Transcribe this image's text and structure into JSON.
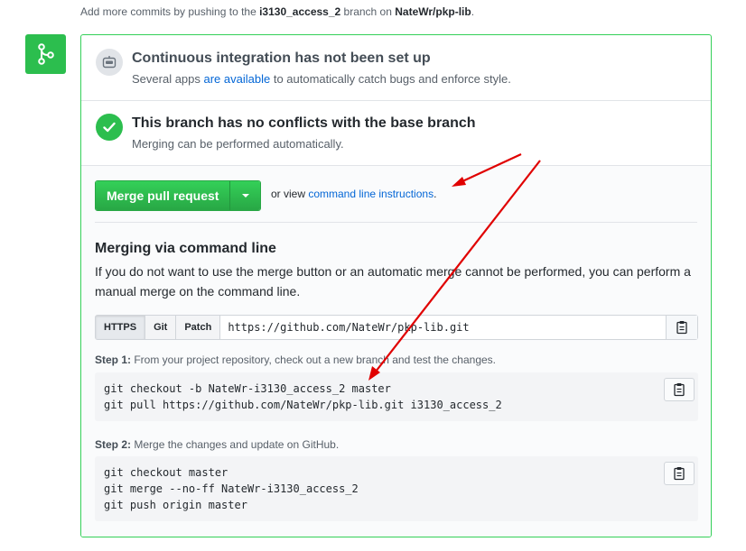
{
  "top_note": {
    "prefix": "Add more commits by pushing to the ",
    "branch": "i3130_access_2",
    "middle": " branch on ",
    "repo": "NateWr/pkp-lib",
    "suffix": "."
  },
  "badge": {
    "icon": "git-merge-icon",
    "color": "#2cbe4e"
  },
  "ci_status": {
    "icon": "ci-robot-icon",
    "title": "Continuous integration has not been set up",
    "desc_prefix": "Several apps ",
    "desc_link": "are available",
    "desc_suffix": " to automatically catch bugs and enforce style."
  },
  "conflict_status": {
    "icon": "check-circle-icon",
    "title": "This branch has no conflicts with the base branch",
    "desc": "Merging can be performed automatically."
  },
  "merge": {
    "button_label": "Merge pull request",
    "caret_icon": "caret-down-icon",
    "or_view": "or view ",
    "instructions_link": "command line instructions",
    "period": "."
  },
  "cmdline": {
    "title": "Merging via command line",
    "desc": "If you do not want to use the merge button or an automatic merge cannot be performed, you can perform a manual merge on the command line.",
    "protocols": [
      "HTTPS",
      "Git",
      "Patch"
    ],
    "selected_protocol": "HTTPS",
    "url": "https://github.com/NateWr/pkp-lib.git",
    "copy_icon": "clipboard-icon",
    "step1": {
      "label": "Step 1:",
      "text": " From your project repository, check out a new branch and test the changes.",
      "code": [
        "git checkout -b NateWr-i3130_access_2 master",
        "git pull https://github.com/NateWr/pkp-lib.git i3130_access_2"
      ]
    },
    "step2": {
      "label": "Step 2:",
      "text": " Merge the changes and update on GitHub.",
      "code": [
        "git checkout master",
        "git merge --no-ff NateWr-i3130_access_2",
        "git push origin master"
      ]
    }
  },
  "annotation_color": "#e00000",
  "colors": {
    "success": "#2cbe4e",
    "link": "#0366d6",
    "border": "#34d058"
  }
}
